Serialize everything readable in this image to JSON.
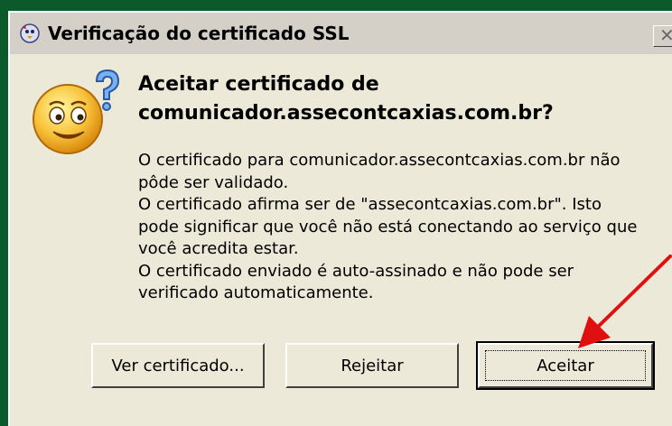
{
  "window": {
    "title": "Verificação do certificado SSL",
    "close_symbol": "✕",
    "app_icon": "bird-app-icon"
  },
  "dialog": {
    "icon": "question-smiley-icon",
    "heading_lines": [
      "Aceitar certificado de",
      "comunicador.assecontcaxias.com.br?"
    ],
    "body_lines": [
      "O certificado para comunicador.assecontcaxias.com.br não",
      "pôde ser validado.",
      "O certificado afirma ser de \"assecontcaxias.com.br\". Isto",
      "pode significar que você não está conectando ao serviço que",
      "você acredita estar.",
      "O certificado enviado é auto-assinado e não pode ser",
      "verificado automaticamente."
    ]
  },
  "buttons": {
    "view": "Ver certificado...",
    "reject": "Rejeitar",
    "accept": "Aceitar"
  },
  "colors": {
    "desktop": "#0c5a2b",
    "window_face": "#d4d0c8",
    "client_area": "#ece9d8",
    "annotation_arrow": "#e01010"
  }
}
